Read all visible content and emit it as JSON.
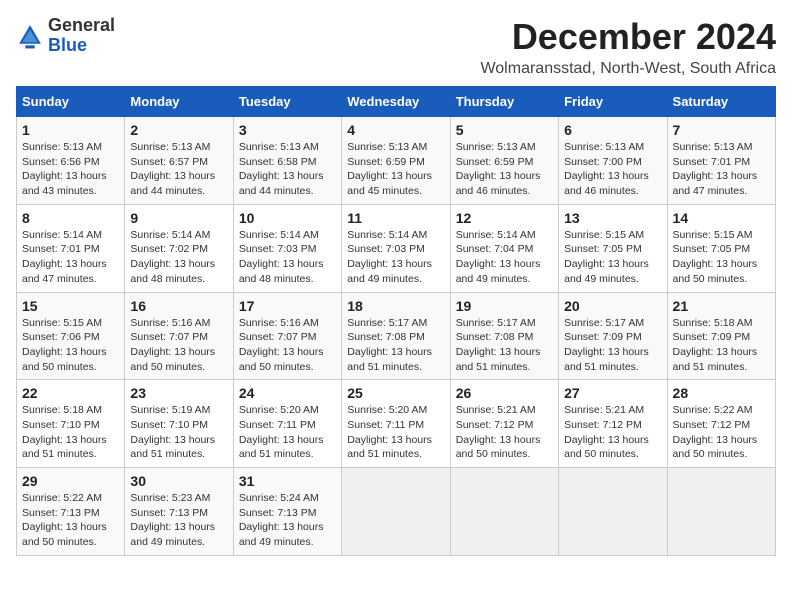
{
  "header": {
    "logo_line1": "General",
    "logo_line2": "Blue",
    "month_title": "December 2024",
    "location": "Wolmaransstad, North-West, South Africa"
  },
  "days_of_week": [
    "Sunday",
    "Monday",
    "Tuesday",
    "Wednesday",
    "Thursday",
    "Friday",
    "Saturday"
  ],
  "weeks": [
    [
      {
        "day": 1,
        "sunrise": "5:13 AM",
        "sunset": "6:56 PM",
        "daylight": "13 hours and 43 minutes."
      },
      {
        "day": 2,
        "sunrise": "5:13 AM",
        "sunset": "6:57 PM",
        "daylight": "13 hours and 44 minutes."
      },
      {
        "day": 3,
        "sunrise": "5:13 AM",
        "sunset": "6:58 PM",
        "daylight": "13 hours and 44 minutes."
      },
      {
        "day": 4,
        "sunrise": "5:13 AM",
        "sunset": "6:59 PM",
        "daylight": "13 hours and 45 minutes."
      },
      {
        "day": 5,
        "sunrise": "5:13 AM",
        "sunset": "6:59 PM",
        "daylight": "13 hours and 46 minutes."
      },
      {
        "day": 6,
        "sunrise": "5:13 AM",
        "sunset": "7:00 PM",
        "daylight": "13 hours and 46 minutes."
      },
      {
        "day": 7,
        "sunrise": "5:13 AM",
        "sunset": "7:01 PM",
        "daylight": "13 hours and 47 minutes."
      }
    ],
    [
      {
        "day": 8,
        "sunrise": "5:14 AM",
        "sunset": "7:01 PM",
        "daylight": "13 hours and 47 minutes."
      },
      {
        "day": 9,
        "sunrise": "5:14 AM",
        "sunset": "7:02 PM",
        "daylight": "13 hours and 48 minutes."
      },
      {
        "day": 10,
        "sunrise": "5:14 AM",
        "sunset": "7:03 PM",
        "daylight": "13 hours and 48 minutes."
      },
      {
        "day": 11,
        "sunrise": "5:14 AM",
        "sunset": "7:03 PM",
        "daylight": "13 hours and 49 minutes."
      },
      {
        "day": 12,
        "sunrise": "5:14 AM",
        "sunset": "7:04 PM",
        "daylight": "13 hours and 49 minutes."
      },
      {
        "day": 13,
        "sunrise": "5:15 AM",
        "sunset": "7:05 PM",
        "daylight": "13 hours and 49 minutes."
      },
      {
        "day": 14,
        "sunrise": "5:15 AM",
        "sunset": "7:05 PM",
        "daylight": "13 hours and 50 minutes."
      }
    ],
    [
      {
        "day": 15,
        "sunrise": "5:15 AM",
        "sunset": "7:06 PM",
        "daylight": "13 hours and 50 minutes."
      },
      {
        "day": 16,
        "sunrise": "5:16 AM",
        "sunset": "7:07 PM",
        "daylight": "13 hours and 50 minutes."
      },
      {
        "day": 17,
        "sunrise": "5:16 AM",
        "sunset": "7:07 PM",
        "daylight": "13 hours and 50 minutes."
      },
      {
        "day": 18,
        "sunrise": "5:17 AM",
        "sunset": "7:08 PM",
        "daylight": "13 hours and 51 minutes."
      },
      {
        "day": 19,
        "sunrise": "5:17 AM",
        "sunset": "7:08 PM",
        "daylight": "13 hours and 51 minutes."
      },
      {
        "day": 20,
        "sunrise": "5:17 AM",
        "sunset": "7:09 PM",
        "daylight": "13 hours and 51 minutes."
      },
      {
        "day": 21,
        "sunrise": "5:18 AM",
        "sunset": "7:09 PM",
        "daylight": "13 hours and 51 minutes."
      }
    ],
    [
      {
        "day": 22,
        "sunrise": "5:18 AM",
        "sunset": "7:10 PM",
        "daylight": "13 hours and 51 minutes."
      },
      {
        "day": 23,
        "sunrise": "5:19 AM",
        "sunset": "7:10 PM",
        "daylight": "13 hours and 51 minutes."
      },
      {
        "day": 24,
        "sunrise": "5:20 AM",
        "sunset": "7:11 PM",
        "daylight": "13 hours and 51 minutes."
      },
      {
        "day": 25,
        "sunrise": "5:20 AM",
        "sunset": "7:11 PM",
        "daylight": "13 hours and 51 minutes."
      },
      {
        "day": 26,
        "sunrise": "5:21 AM",
        "sunset": "7:12 PM",
        "daylight": "13 hours and 50 minutes."
      },
      {
        "day": 27,
        "sunrise": "5:21 AM",
        "sunset": "7:12 PM",
        "daylight": "13 hours and 50 minutes."
      },
      {
        "day": 28,
        "sunrise": "5:22 AM",
        "sunset": "7:12 PM",
        "daylight": "13 hours and 50 minutes."
      }
    ],
    [
      {
        "day": 29,
        "sunrise": "5:22 AM",
        "sunset": "7:13 PM",
        "daylight": "13 hours and 50 minutes."
      },
      {
        "day": 30,
        "sunrise": "5:23 AM",
        "sunset": "7:13 PM",
        "daylight": "13 hours and 49 minutes."
      },
      {
        "day": 31,
        "sunrise": "5:24 AM",
        "sunset": "7:13 PM",
        "daylight": "13 hours and 49 minutes."
      },
      null,
      null,
      null,
      null
    ]
  ]
}
